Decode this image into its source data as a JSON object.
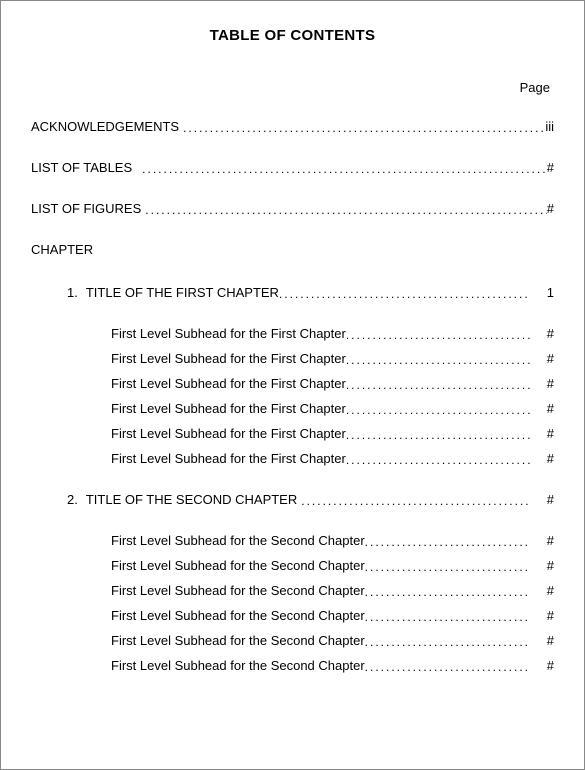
{
  "title": "TABLE OF CONTENTS",
  "pageLabel": "Page",
  "frontmatter": [
    {
      "label": "ACKNOWLEDGEMENTS",
      "page": "iii"
    },
    {
      "label": "LIST OF TABLES",
      "page": "#"
    },
    {
      "label": "LIST OF FIGURES",
      "page": "#"
    }
  ],
  "chapterHeading": "CHAPTER",
  "chapters": [
    {
      "num": "1.",
      "title": "TITLE OF THE FIRST CHAPTER",
      "page": "1",
      "subs": [
        {
          "label": "First Level Subhead for the First Chapter",
          "page": "#"
        },
        {
          "label": "First Level Subhead for the First Chapter",
          "page": "#"
        },
        {
          "label": "First Level Subhead for the First Chapter",
          "page": "#"
        },
        {
          "label": "First Level Subhead for the First Chapter",
          "page": "#"
        },
        {
          "label": "First Level Subhead for the First Chapter",
          "page": "#"
        },
        {
          "label": "First Level Subhead for the First Chapter",
          "page": "#"
        }
      ]
    },
    {
      "num": "2.",
      "title": "TITLE OF THE SECOND CHAPTER",
      "page": "#",
      "subs": [
        {
          "label": "First Level Subhead for the Second Chapter",
          "page": "#"
        },
        {
          "label": "First Level Subhead for the Second Chapter",
          "page": "#"
        },
        {
          "label": "First Level Subhead for the Second Chapter",
          "page": "#"
        },
        {
          "label": "First Level Subhead for the Second Chapter",
          "page": "#"
        },
        {
          "label": "First Level Subhead for the Second Chapter",
          "page": "#"
        },
        {
          "label": "First Level Subhead for the Second Chapter",
          "page": "#"
        }
      ]
    }
  ]
}
